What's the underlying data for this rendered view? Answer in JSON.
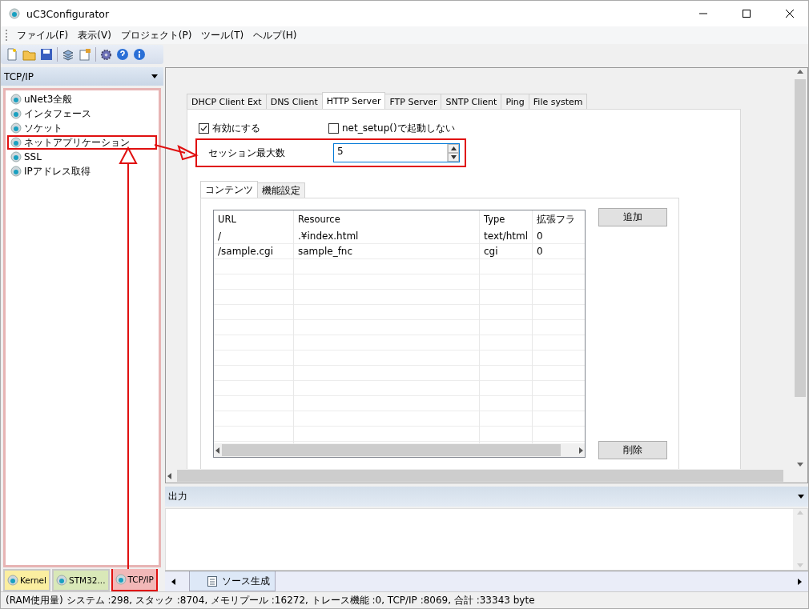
{
  "window": {
    "title": "uC3Configurator"
  },
  "menu": [
    "ファイル(F)",
    "表示(V)",
    "プロジェクト(P)",
    "ツール(T)",
    "ヘルプ(H)"
  ],
  "left_panel": {
    "title": "TCP/IP",
    "tree": [
      {
        "label": "uNet3全般",
        "highlighted": false
      },
      {
        "label": "インタフェース",
        "highlighted": false
      },
      {
        "label": "ソケット",
        "highlighted": false
      },
      {
        "label": "ネットアプリケーション",
        "highlighted": true
      },
      {
        "label": "SSL",
        "highlighted": false
      },
      {
        "label": "IPアドレス取得",
        "highlighted": false
      }
    ],
    "tabs": [
      {
        "label": "Kernel",
        "selected": false,
        "highlighted": false,
        "color": "#fbeea0"
      },
      {
        "label": "STM32...",
        "selected": false,
        "highlighted": false,
        "color": "#d9e8b8"
      },
      {
        "label": "TCP/IP",
        "selected": true,
        "highlighted": true,
        "color": "#f2b8b8"
      }
    ]
  },
  "tabs": [
    {
      "label": "DHCP Client Ext",
      "selected": false
    },
    {
      "label": "DNS Client",
      "selected": false
    },
    {
      "label": "HTTP Server",
      "selected": true
    },
    {
      "label": "FTP Server",
      "selected": false
    },
    {
      "label": "SNTP Client",
      "selected": false
    },
    {
      "label": "Ping",
      "selected": false
    },
    {
      "label": "File system",
      "selected": false
    }
  ],
  "options": [
    {
      "label": "有効にする",
      "checked": true
    },
    {
      "label": "net_setup()で起動しない",
      "checked": false
    }
  ],
  "session": {
    "label": "セッション最大数",
    "value": "5",
    "highlighted": true
  },
  "sub_tabs": [
    {
      "label": "コンテンツ",
      "selected": true
    },
    {
      "label": "機能設定",
      "selected": false
    }
  ],
  "table": {
    "columns": [
      "URL",
      "Resource",
      "Type",
      "拡張フラ"
    ],
    "rows": [
      [
        "/",
        ".¥index.html",
        "text/html",
        "0"
      ],
      [
        "/sample.cgi",
        "sample_fnc",
        "cgi",
        "0"
      ]
    ]
  },
  "buttons": [
    "追加",
    "削除"
  ],
  "output": {
    "title": "出力"
  },
  "doc_tabs": [
    {
      "label": "ソース生成",
      "selected": true
    }
  ],
  "status_bar": "(RAM使用量) システム :298, スタック :8704, メモリプール :16272, トレース機能 :0, TCP/IP :8069, 合計 :33343 byte"
}
